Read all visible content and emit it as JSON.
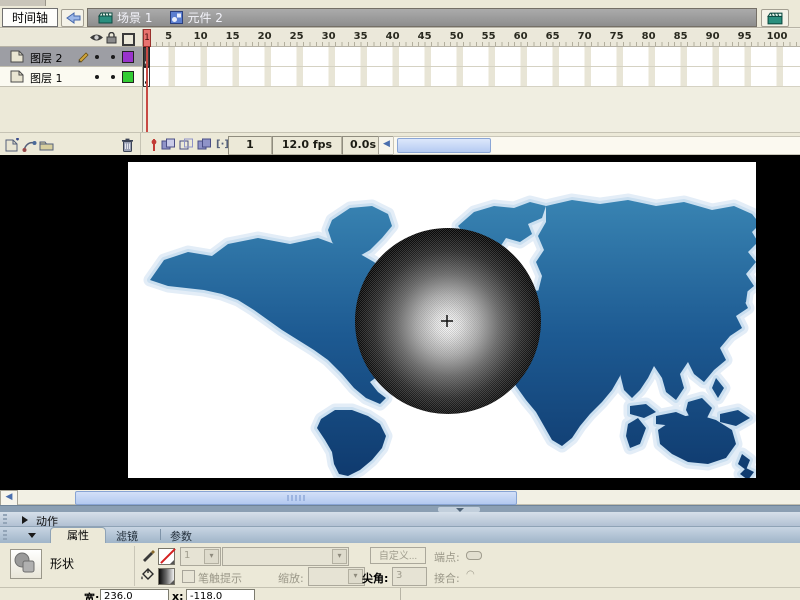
{
  "top_bar": {
    "timeline_panel_title": "时间轴",
    "scene_label": "场景 1",
    "symbol_label": "元件 2"
  },
  "timeline": {
    "layers": [
      {
        "name": "图层 2",
        "selected": true,
        "outline_color": "#9933cc"
      },
      {
        "name": "图层 1",
        "selected": false,
        "outline_color": "#33cc33"
      }
    ],
    "ruler_numbers": [
      5,
      10,
      15,
      20,
      25,
      30,
      35,
      40,
      45,
      50,
      55,
      60,
      65,
      70,
      75,
      80,
      85,
      90,
      95,
      100
    ],
    "playhead_frame": "1",
    "current_frame": "1",
    "frame_rate": "12.0 fps",
    "elapsed_time": "0.0s"
  },
  "stage": {
    "background_color": "#000000",
    "canvas_color": "#ffffff",
    "map_color_top": "#3a86b4",
    "map_color_bottom": "#0f3a6e",
    "selected_shape": "radial-gradient-sphere"
  },
  "panels": {
    "actions_label": "动作",
    "tabs": [
      {
        "label": "属性",
        "active": true
      },
      {
        "label": "滤镜",
        "active": false
      },
      {
        "label": "参数",
        "active": false
      }
    ]
  },
  "properties": {
    "selection_type": "形状",
    "stroke_height": "1",
    "custom_button": "自定义...",
    "cap_label": "端点:",
    "stroke_hint_label": "笔触提示",
    "scale_label": "缩放:",
    "miter_label": "尖角:",
    "miter_value": "3",
    "join_label": "接合:",
    "width_label": "宽:",
    "width_value": "236.0",
    "x_label": "x:",
    "x_value": "-118.0"
  }
}
